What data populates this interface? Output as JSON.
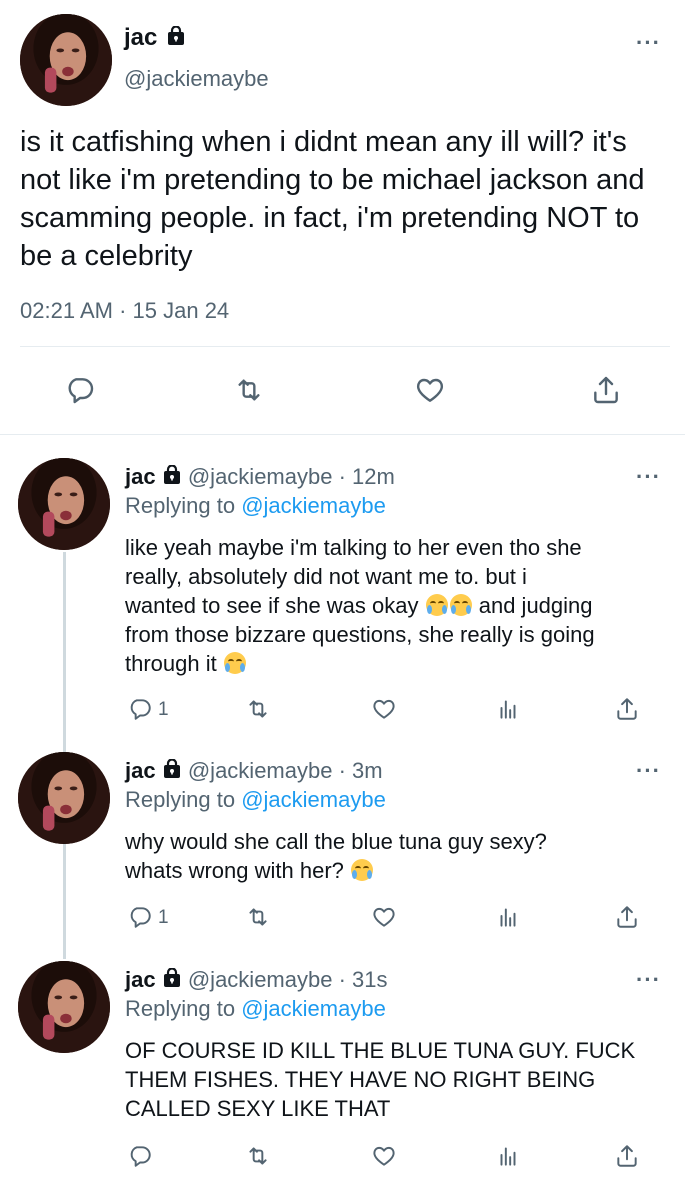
{
  "main_tweet": {
    "display_name": "jac",
    "handle": "@jackiemaybe",
    "text": "is it catfishing when i didnt mean any ill will? it's not like i'm pretending to be michael jackson and scamming people. in fact, i'm pretending NOT to be a celebrity",
    "time": "02:21 AM",
    "separator": "·",
    "date": "15 Jan 24",
    "more_icon": "more-horizontal-icon"
  },
  "replies": [
    {
      "display_name": "jac",
      "handle": "@jackiemaybe",
      "time": "12m",
      "replying_prefix": "Replying to",
      "replying_to": "@jackiemaybe",
      "text_lines": [
        "like yeah maybe i'm talking to her even tho she",
        "really, absolutely did not want me to. but i",
        "wanted to see if she was okay",
        " and judging",
        "from those bizzare questions, she really is going",
        "through it"
      ],
      "reply_count": "1"
    },
    {
      "display_name": "jac",
      "handle": "@jackiemaybe",
      "time": "3m",
      "replying_prefix": "Replying to",
      "replying_to": "@jackiemaybe",
      "text_lines": [
        "why would she call the blue tuna guy sexy?",
        "whats wrong with her?"
      ],
      "reply_count": "1"
    },
    {
      "display_name": "jac",
      "handle": "@jackiemaybe",
      "time": "31s",
      "replying_prefix": "Replying to",
      "replying_to": "@jackiemaybe",
      "text_lines": [
        "OF COURSE ID KILL THE BLUE TUNA GUY. FUCK",
        "THEM FISHES. THEY HAVE NO RIGHT BEING",
        "CALLED SEXY LIKE THAT"
      ],
      "reply_count": ""
    }
  ],
  "icons": {
    "lock": "lock-icon",
    "reply": "reply-icon",
    "retweet": "retweet-icon",
    "like": "heart-icon",
    "views": "views-icon",
    "share": "share-icon",
    "emoji": "loudly-crying-face-emoji"
  },
  "colors": {
    "accent": "#1d9bf0",
    "text": "#0f1419",
    "secondary": "#536471",
    "divider": "#e6ecf0"
  }
}
